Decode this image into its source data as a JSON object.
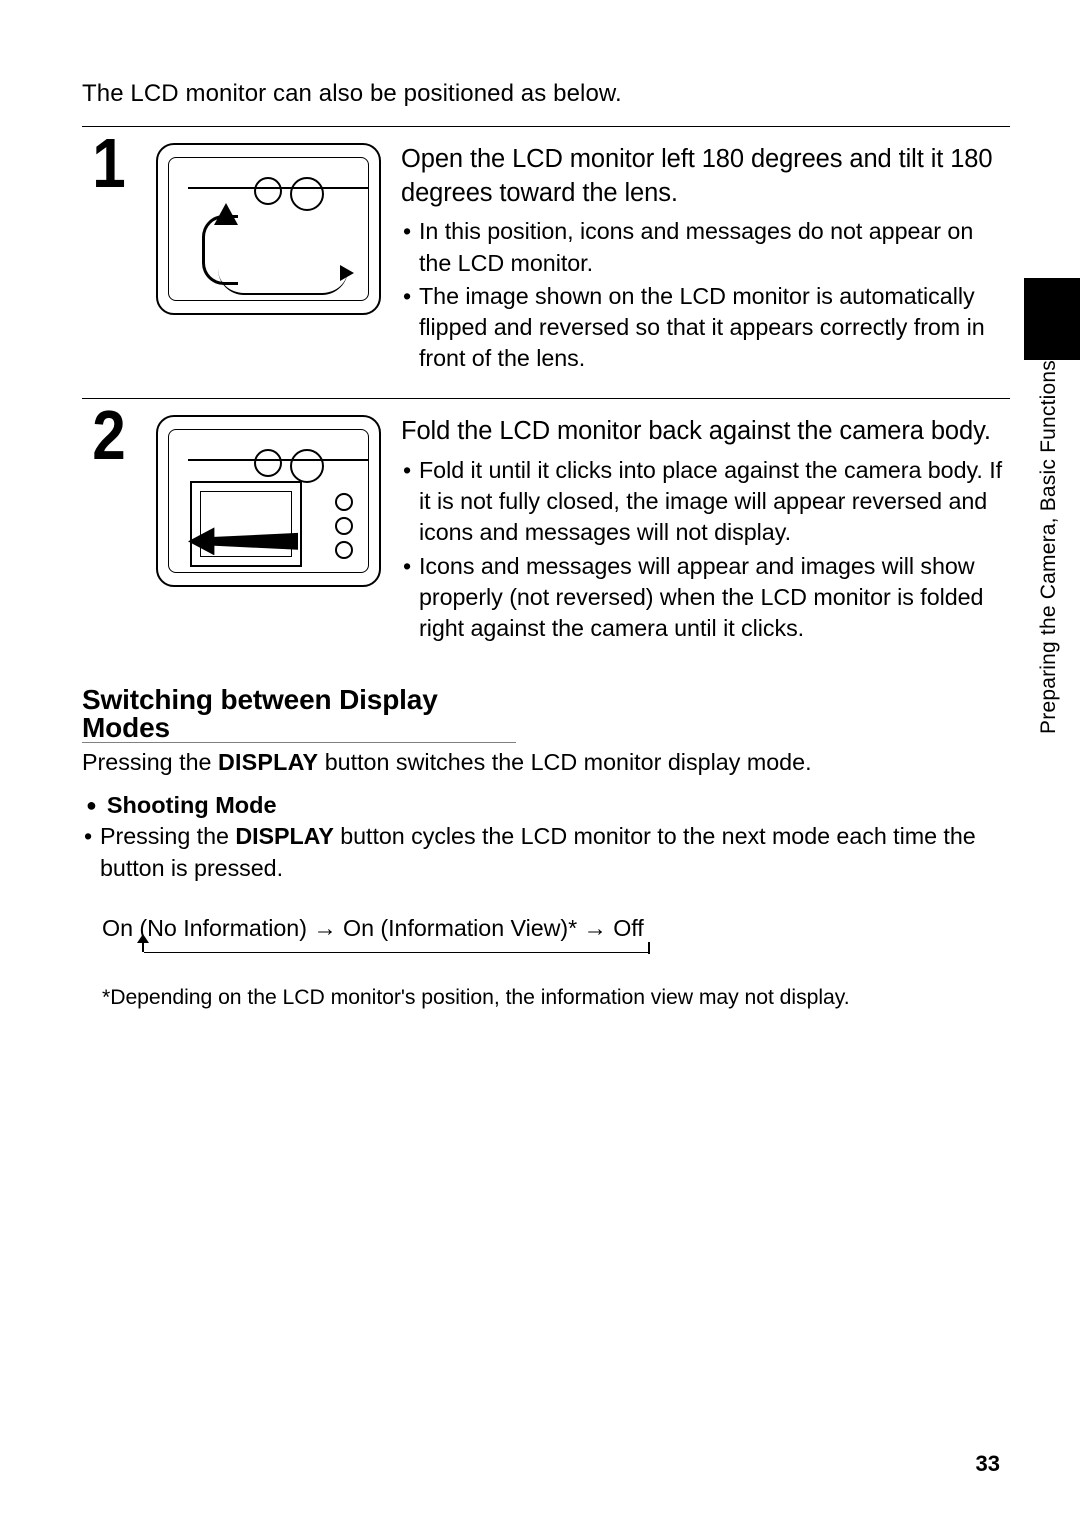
{
  "sideLabel": "Preparing the Camera, Basic Functions",
  "intro": "The LCD monitor can also be positioned as below.",
  "steps": [
    {
      "num": "1",
      "title": "Open the LCD monitor left 180 degrees and tilt it 180 degrees toward the lens.",
      "bullets": [
        "In this position, icons and messages do not appear on the LCD monitor.",
        "The image shown on the LCD monitor is automatically flipped and reversed so that it appears correctly from in front of the lens."
      ]
    },
    {
      "num": "2",
      "title": "Fold the LCD monitor back against the camera body.",
      "bullets": [
        "Fold it until it clicks into place against the camera body. If it is not fully closed, the image will appear reversed and icons and messages will not display.",
        "Icons and messages will appear and images will show properly (not reversed) when the LCD monitor is folded right against the camera until it clicks."
      ]
    }
  ],
  "sectionHeading": "Switching between Display Modes",
  "sectionBody": {
    "pre": "Pressing the ",
    "bold": "DISPLAY",
    "post": " button switches the LCD monitor display mode."
  },
  "subHeading": "Shooting Mode",
  "subBullet": {
    "pre": "Pressing the ",
    "bold": "DISPLAY",
    "post": " button cycles the LCD monitor to the next mode each time the button is pressed."
  },
  "cycleLine": "On (No Information) → On (Information View)* → Off",
  "footnote": "*Depending on the LCD monitor's position, the information view may not display.",
  "pageNum": "33"
}
